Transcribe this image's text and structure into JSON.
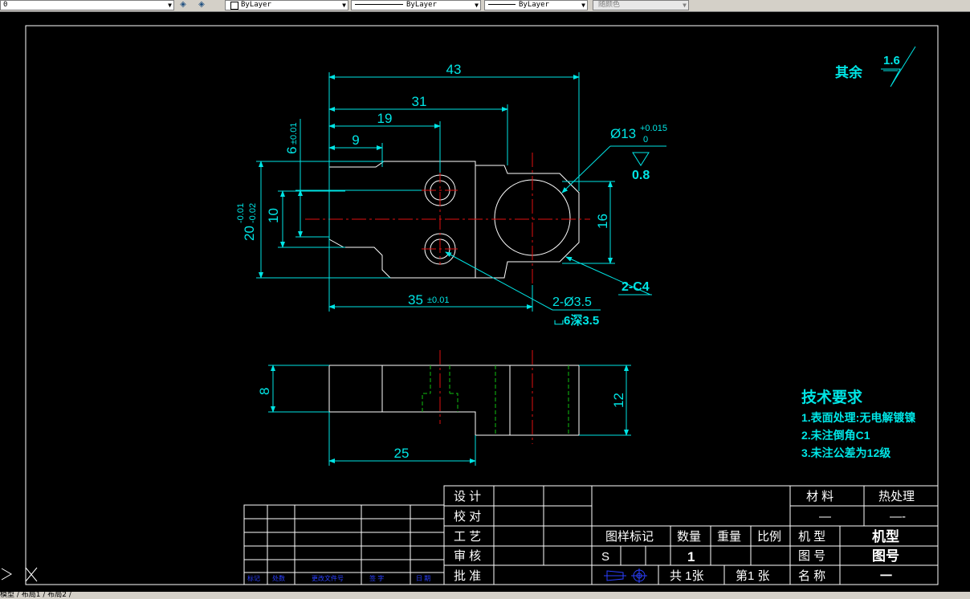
{
  "toolbar": {
    "layer_value": "0",
    "color_value": "ByLayer",
    "linetype_value": "ByLayer",
    "lineweight_value": "ByLayer",
    "plotstyle_value": "随颜色"
  },
  "drawing": {
    "dims": {
      "d43": "43",
      "d31": "31",
      "d19": "19",
      "d9": "9",
      "d6": "6",
      "d6_tol": "±0.01",
      "d20": "20",
      "d20_tol_up": "-0.01",
      "d20_tol_low": "-0.02",
      "d10": "10",
      "d16": "16",
      "d35": "35",
      "d35_tol": "±0.01",
      "dia13": "Ø13",
      "dia13_tol_up": "+0.015",
      "dia13_tol_low": "0",
      "rough08": "0.8",
      "chamfer": "2-C4",
      "holes": "2-Ø3.5",
      "holes_depth": "⌴6深3.5",
      "d8": "8",
      "d12": "12",
      "d25": "25"
    },
    "other_surface_label": "其余",
    "other_surface_rough": "1.6",
    "tech_req": {
      "title": "技术要求",
      "items": [
        "1.表面处理:无电解镀镍",
        "2.未注倒角C1",
        "3.未注公差为12级"
      ]
    }
  },
  "title_block": {
    "left_labels": [
      "设 计",
      "校 对",
      "工 艺",
      "审 核",
      "批 准"
    ],
    "material_label": "材 料",
    "heat_label": "热处理",
    "material_value": "—",
    "heat_value": "—-",
    "headers": [
      "图样标记",
      "数量",
      "重量",
      "比例"
    ],
    "mark_value": "S",
    "qty_value": "1",
    "model_label": "机 型",
    "model_value": "机型",
    "drawno_label": "图 号",
    "drawno_value": "图号",
    "name_label": "名 称",
    "name_value": "一",
    "total_sheets": "共 1张",
    "sheet_no": "第1 张",
    "rev_footer": [
      "标记",
      "处数",
      "更改文件号",
      "签 字",
      "日 期"
    ]
  },
  "status": {
    "tabs_text": "模型 / 布局1 / 布局2 /"
  },
  "colors": {
    "outline": "#ffffff",
    "dimension": "#00e5e5",
    "centerline": "#e01010",
    "hidden": "#10c010",
    "background": "#000000",
    "frame": "#ffffff"
  }
}
